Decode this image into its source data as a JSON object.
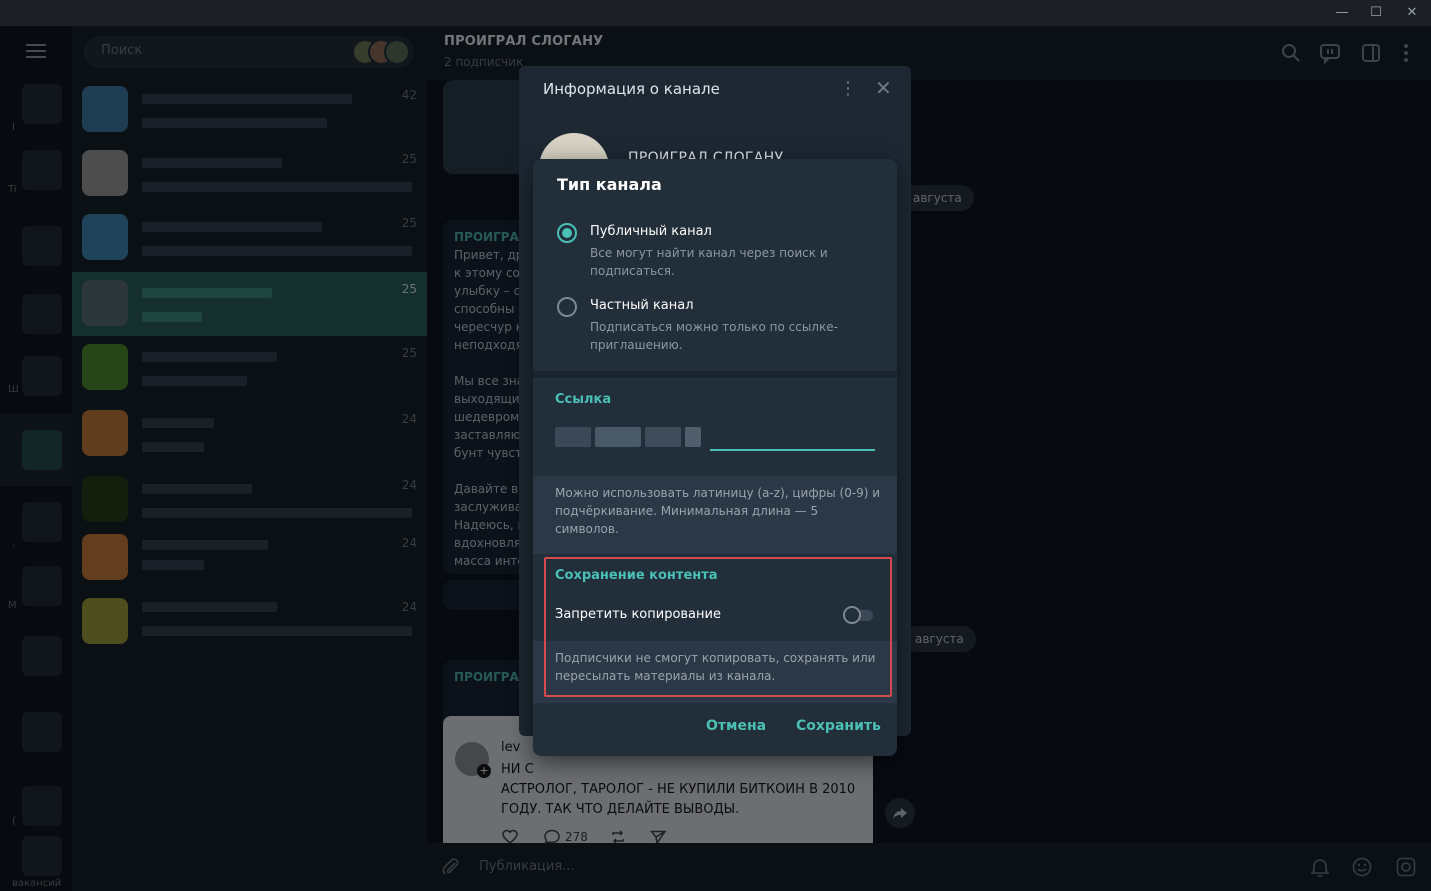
{
  "window": {
    "minimize": "—",
    "maximize": "☐",
    "close": "✕"
  },
  "sidebar": {
    "folder_letters": [
      "I",
      "Ti",
      "Ш",
      ".",
      "М",
      "(",
      "вакансий"
    ]
  },
  "chatlist": {
    "search_placeholder": "Поиск",
    "times": [
      "42",
      "25",
      "25",
      "25",
      "25",
      "24",
      "24",
      "24",
      "24"
    ]
  },
  "chat": {
    "title": "ПРОИГРАЛ СЛОГАНУ",
    "subtitle": "2 подписчик",
    "date_pill_1": "августа",
    "date_pill_2": "августа",
    "message_author_1": "ПРОИГРАЛ",
    "message_lines": [
      "Привет, др",
      "к этому со",
      "улыбку – с",
      "способны",
      "чересчур к",
      "неподходя",
      "",
      "Мы все зна",
      "выходящи",
      "шедевром",
      "заставляю",
      "бунт чувст",
      "",
      "Давайте вм",
      "заслужива",
      "Надеюсь, к",
      "вдохновля",
      "масса инте"
    ],
    "message_author_2": "ПРОИГРАЛ",
    "embed_author": "lev",
    "embed_lines": [
      "НИ С",
      "АСТРОЛОГ, ТАРОЛОГ - НЕ КУПИЛИ БИТКОИН В 2010",
      "ГОДУ. ТАК ЧТО ДЕЛАЙТЕ ВЫВОДЫ."
    ],
    "embed_comments": "278",
    "composer_placeholder": "Публикация..."
  },
  "info_panel": {
    "title": "Информация о канале",
    "channel_name": "ПРОИГРАЛ СЛОГАНУ"
  },
  "dialog": {
    "title": "Тип канала",
    "public_label": "Публичный канал",
    "public_desc": "Все могут найти канал через поиск и подписаться.",
    "private_label": "Частный канал",
    "private_desc": "Подписаться можно только по ссылке-приглашению.",
    "link_section": "Ссылка",
    "link_note": "Можно использовать латиницу (a-z), цифры (0-9) и подчёркивание. Минимальная длина — 5 символов.",
    "content_section": "Сохранение контента",
    "toggle_label": "Запретить копирование",
    "toggle_on": false,
    "content_note": "Подписчики не смогут копировать, сохранять или пересылать материалы из канала.",
    "cancel": "Отмена",
    "save": "Сохранить"
  },
  "colors": {
    "accent": "#4bc0b5",
    "highlight": "#d64a4f",
    "selected_row": "#2b5f5a"
  },
  "icons": [
    "hamburger-icon",
    "search-icon",
    "discussion-icon",
    "sidebar-toggle-icon",
    "more-vertical-icon",
    "close-icon",
    "attach-icon",
    "bell-icon",
    "emoji-icon",
    "camera-icon",
    "heart-icon",
    "comment-icon",
    "repost-icon",
    "share-icon",
    "forward-icon"
  ]
}
